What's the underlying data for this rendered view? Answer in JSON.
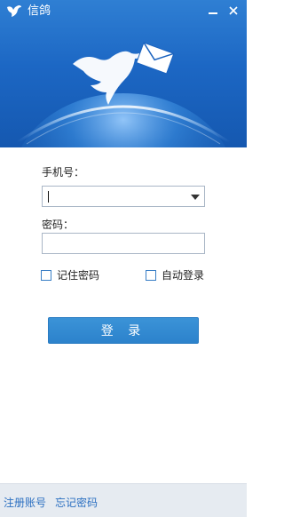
{
  "window": {
    "title": "信鸽",
    "logo_icon": "dove-icon",
    "minimize_icon": "minimize-icon",
    "close_icon": "close-icon"
  },
  "banner": {
    "illustration": "dove-with-envelope-over-globe",
    "colors": {
      "sky": "#1c67c4",
      "glow": "#cfe6ff"
    }
  },
  "form": {
    "phone_label": "手机号：",
    "phone_value": "",
    "password_label": "密码：",
    "password_value": "",
    "remember_label": "记住密码",
    "remember_checked": false,
    "auto_login_label": "自动登录",
    "auto_login_checked": false,
    "login_label": "登 录"
  },
  "footer": {
    "register_label": "注册账号",
    "forgot_label": "忘记密码"
  },
  "colors": {
    "accent": "#2c82cc",
    "link": "#2b6fc1",
    "footer_bg": "#e6ebf1"
  }
}
